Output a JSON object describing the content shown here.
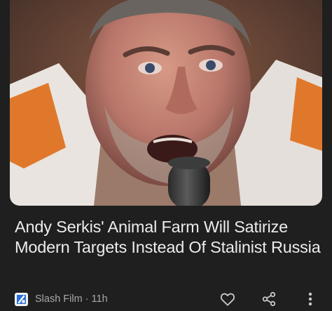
{
  "article": {
    "headline": "Andy Serkis' Animal Farm Will Satirize Modern Targets Instead Of Stalinist Russia",
    "image_icon": "photo-of-man-shouting-into-microphone"
  },
  "meta": {
    "source": "Slash Film",
    "separator": "·",
    "age": "11h",
    "favicon_icon": "slash-film-logo-icon"
  },
  "actions": {
    "like_icon": "heart-icon",
    "share_icon": "share-icon",
    "more_icon": "more-vertical-icon"
  },
  "colors": {
    "background": "#1f1f1f",
    "headline_text": "#ececec",
    "meta_text": "#a8a8a8"
  }
}
